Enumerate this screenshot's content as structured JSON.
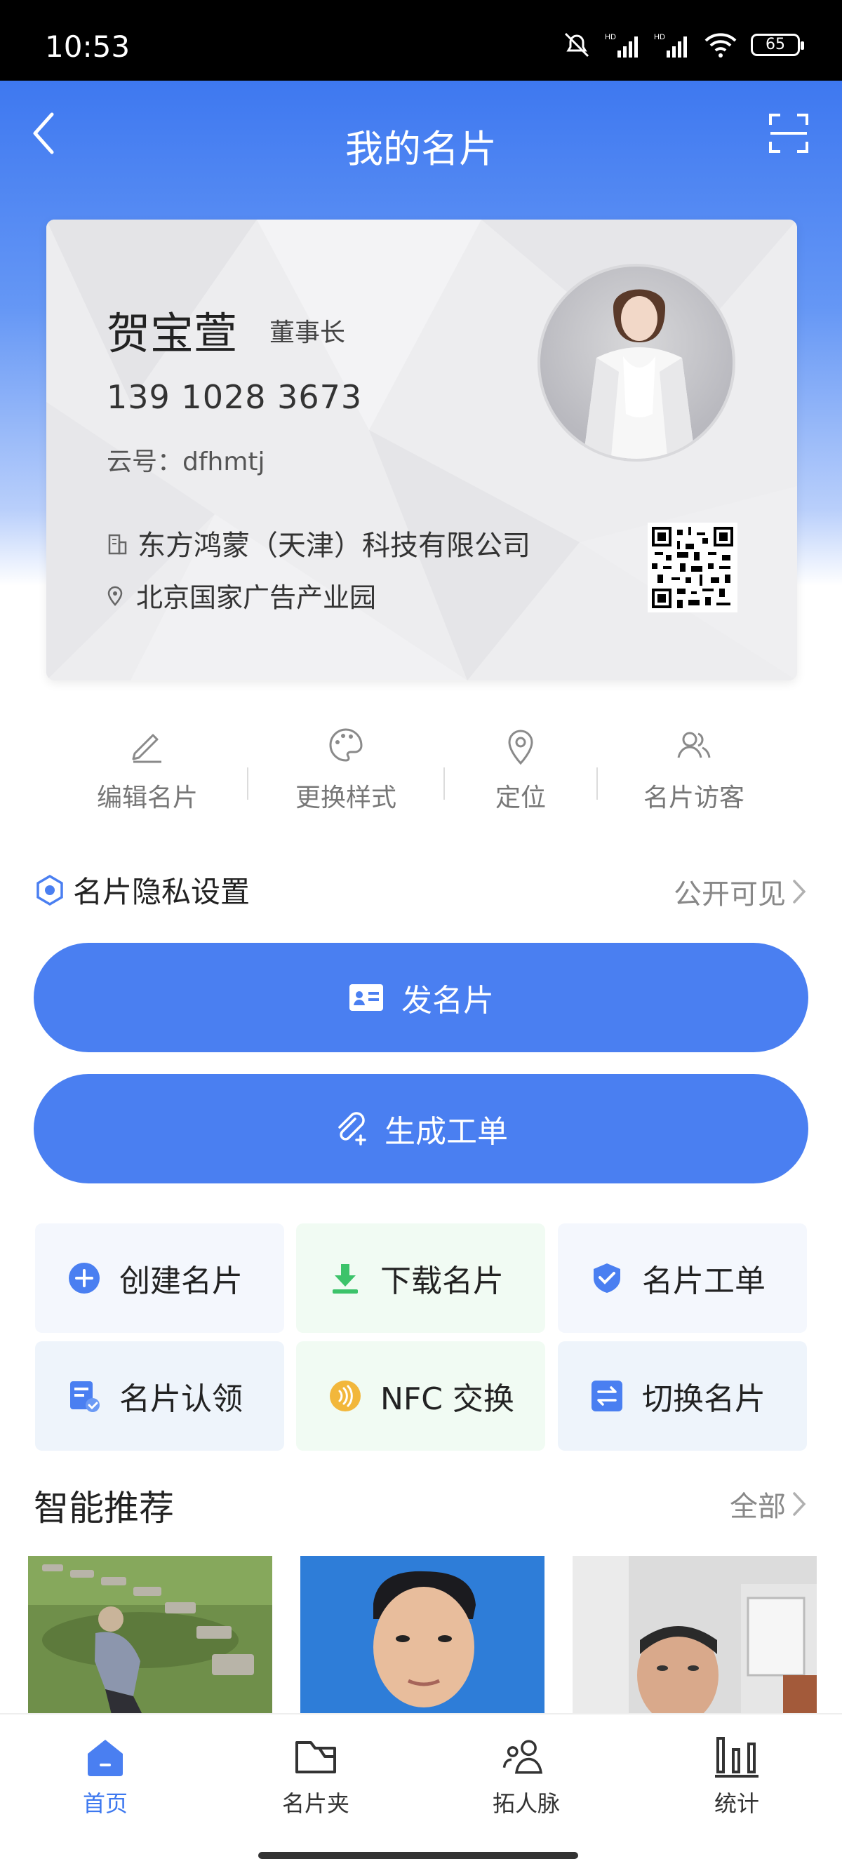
{
  "status_bar": {
    "time": "10:53",
    "battery": "65"
  },
  "nav": {
    "title": "我的名片",
    "back_icon": "chevron-left-icon",
    "scan_icon": "scan-icon"
  },
  "card": {
    "name": "贺宝萱",
    "role": "董事长",
    "phone": "139 1028 3673",
    "cloud_id": "云号：dfhmtj",
    "company": "东方鸿蒙（天津）科技有限公司",
    "address": "北京国家广告产业园"
  },
  "actions": [
    {
      "label": "编辑名片",
      "icon": "edit-icon"
    },
    {
      "label": "更换样式",
      "icon": "palette-icon"
    },
    {
      "label": "定位",
      "icon": "location-icon"
    },
    {
      "label": "名片访客",
      "icon": "visitors-icon"
    }
  ],
  "privacy": {
    "label": "名片隐私设置",
    "value": "公开可见"
  },
  "buttons": {
    "send": "发名片",
    "order": "生成工单"
  },
  "tiles": [
    {
      "label": "创建名片",
      "icon": "plus-circle-icon",
      "color": "#4a7ff1"
    },
    {
      "label": "下载名片",
      "icon": "download-icon",
      "color": "#3cc36a"
    },
    {
      "label": "名片工单",
      "icon": "shield-check-icon",
      "color": "#4a7ff1"
    },
    {
      "label": "名片认领",
      "icon": "claim-icon",
      "color": "#4a7ff1"
    },
    {
      "label": "NFC 交换",
      "icon": "nfc-icon",
      "color": "#f2b73b"
    },
    {
      "label": "切换名片",
      "icon": "swap-icon",
      "color": "#4a7ff1"
    }
  ],
  "recommend": {
    "title": "智能推荐",
    "all": "全部"
  },
  "tabs": [
    {
      "label": "首页",
      "icon": "home-icon",
      "active": true
    },
    {
      "label": "名片夹",
      "icon": "folder-icon",
      "active": false
    },
    {
      "label": "拓人脉",
      "icon": "people-icon",
      "active": false
    },
    {
      "label": "统计",
      "icon": "stats-icon",
      "active": false
    }
  ],
  "colors": {
    "primary": "#4a7ff1",
    "active_tab": "#3d78ef"
  }
}
